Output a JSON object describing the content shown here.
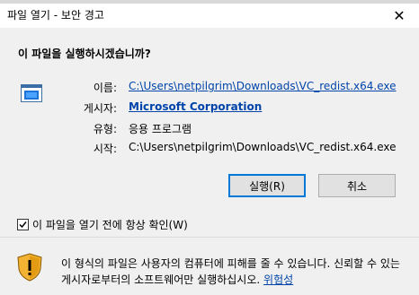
{
  "window": {
    "title": "파일 열기 - 보안 경고",
    "close_glyph": "✕"
  },
  "prompt": {
    "question": "이 파일을 실행하시겠습니까?"
  },
  "details": {
    "name_label": "이름:",
    "name_value": "C:\\Users\\netpilgrim\\Downloads\\VC_redist.x64.exe",
    "publisher_label": "게시자:",
    "publisher_value": "Microsoft Corporation",
    "type_label": "유형:",
    "type_value": "응용 프로그램",
    "from_label": "시작:",
    "from_value": "C:\\Users\\netpilgrim\\Downloads\\VC_redist.x64.exe"
  },
  "buttons": {
    "run_label": "실행(R)",
    "cancel_label": "취소"
  },
  "checkbox": {
    "label": "이 파일을 열기 전에 항상 확인(W)",
    "checked": true
  },
  "warning": {
    "text": "이 형식의 파일은 사용자의 컴퓨터에 피해를 줄 수 있습니다. 신뢰할 수 있는 게시자로부터의 소프트웨어만 실행하십시오.",
    "risk_link": "위험성"
  },
  "colors": {
    "link": "#0044aa",
    "primary_border": "#0078d7",
    "background": "#f0f0f0"
  },
  "icons": [
    "application-window-icon",
    "security-shield-icon",
    "close-icon",
    "checkmark-icon"
  ]
}
